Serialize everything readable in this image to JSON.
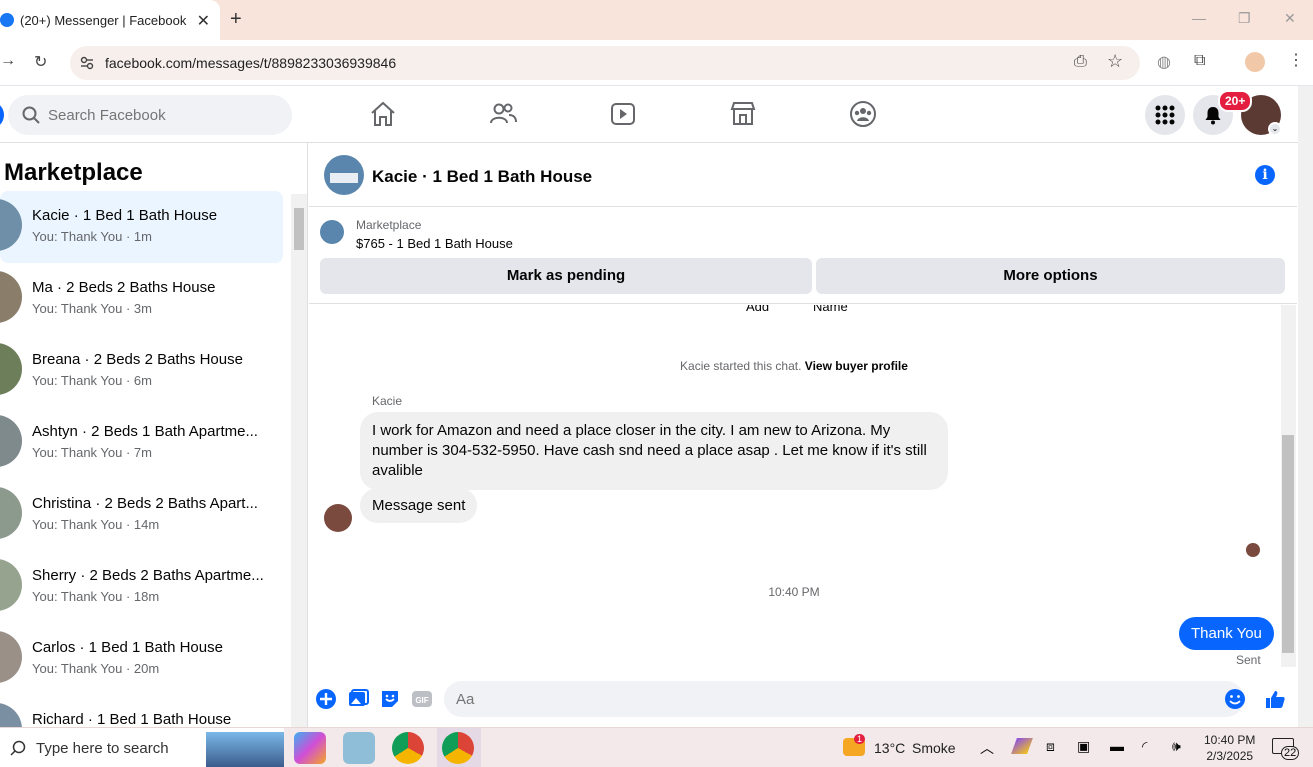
{
  "browser": {
    "tab_title": "(20+) Messenger | Facebook",
    "url": "facebook.com/messages/t/8898233036939846"
  },
  "facebook": {
    "search_placeholder": "Search Facebook",
    "notifications_badge": "20+"
  },
  "sidebar": {
    "title": "Marketplace",
    "conversations": [
      {
        "name": "Kacie · 1 Bed 1 Bath House",
        "sub": "You: Thank You · 1m",
        "active": true
      },
      {
        "name": "Ma · 2 Beds 2 Baths House",
        "sub": "You: Thank You · 3m"
      },
      {
        "name": "Breana · 2 Beds 2 Baths House",
        "sub": "You: Thank You · 6m"
      },
      {
        "name": "Ashtyn · 2 Beds 1 Bath Apartme...",
        "sub": "You: Thank You · 7m"
      },
      {
        "name": "Christina · 2 Beds 2 Baths Apart...",
        "sub": "You: Thank You · 14m"
      },
      {
        "name": "Sherry · 2 Beds 2 Baths Apartme...",
        "sub": "You: Thank You · 18m"
      },
      {
        "name": "Carlos · 1 Bed 1 Bath House",
        "sub": "You: Thank You · 20m"
      },
      {
        "name": "Richard · 1 Bed 1 Bath House",
        "sub": ""
      }
    ]
  },
  "chat": {
    "title": "Kacie · 1 Bed 1 Bath House",
    "listing_source": "Marketplace",
    "listing_price": "$765 - 1 Bed 1 Bath House",
    "mark_pending": "Mark as pending",
    "more_options": "More options",
    "cutoff_add": "Add",
    "cutoff_name": "Name",
    "started_text": "Kacie started this chat.",
    "view_profile": "View buyer profile",
    "sender": "Kacie",
    "incoming_message": "I work for Amazon and need a place closer in the city.  I am new to Arizona.  My number is 304-532-5950.  Have cash snd need a place asap . Let me know if it's still avalible",
    "auto_message": "Message sent",
    "timestamp": "10:40 PM",
    "outgoing_message": "Thank You",
    "sent_label": "Sent",
    "composer_placeholder": "Aa"
  },
  "taskbar": {
    "search_placeholder": "Type here to search",
    "temperature": "13°C",
    "weather": "Smoke",
    "time": "10:40 PM",
    "date": "2/3/2025",
    "notification_count": "22",
    "weather_alert": "1"
  },
  "colors": {
    "facebook_blue": "#0866ff",
    "badge_red": "#e41e3f",
    "active_row": "#ebf5ff"
  }
}
